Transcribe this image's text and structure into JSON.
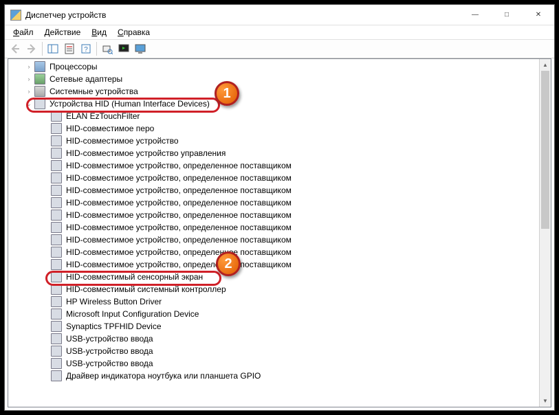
{
  "window": {
    "title": "Диспетчер устройств"
  },
  "menu": {
    "file": "Файл",
    "action": "Действие",
    "view": "Вид",
    "help": "Справка"
  },
  "tree": {
    "processors": "Процессоры",
    "network": "Сетевые адаптеры",
    "system": "Системные устройства",
    "hid_category": "Устройства HID (Human Interface Devices)",
    "hid_items": [
      "ELAN EzTouchFilter",
      "HID-совместимое перо",
      "HID-совместимое устройство",
      "HID-совместимое устройство управления",
      "HID-совместимое устройство, определенное поставщиком",
      "HID-совместимое устройство, определенное поставщиком",
      "HID-совместимое устройство, определенное поставщиком",
      "HID-совместимое устройство, определенное поставщиком",
      "HID-совместимое устройство, определенное поставщиком",
      "HID-совместимое устройство, определенное поставщиком",
      "HID-совместимое устройство, определенное поставщиком",
      "HID-совместимое устройство, определенное поставщиком",
      "HID-совместимое устройство, определенное поставщиком",
      "HID-совместимый сенсорный экран",
      "HID-совместимый системный контроллер",
      "HP Wireless Button Driver",
      "Microsoft Input Configuration Device",
      "Synaptics TPFHID Device",
      "USB-устройство ввода",
      "USB-устройство ввода",
      "USB-устройство ввода",
      "Драйвер индикатора ноутбука или планшета GPIO"
    ]
  },
  "annotations": {
    "badge1": "1",
    "badge2": "2"
  }
}
